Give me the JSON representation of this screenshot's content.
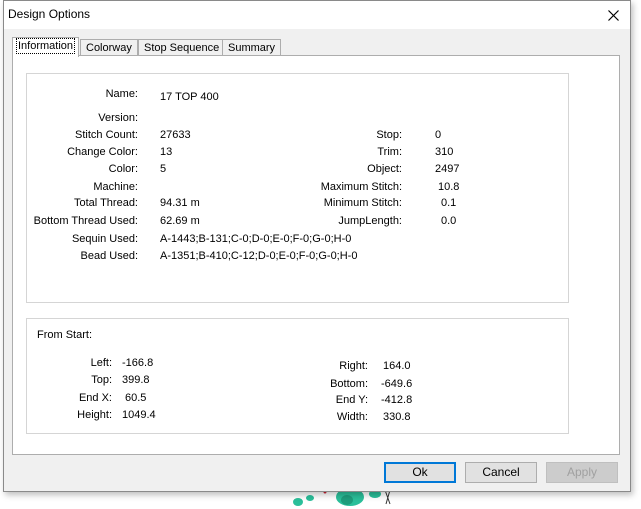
{
  "dialog": {
    "title": "Design Options",
    "tabs": [
      "Information",
      "Colorway",
      "Stop Sequence",
      "Summary"
    ],
    "active_tab": "Information",
    "buttons": {
      "ok": "Ok",
      "cancel": "Cancel",
      "apply": "Apply"
    }
  },
  "info": {
    "name": {
      "label": "Name:",
      "value": "17 TOP 400"
    },
    "left": [
      {
        "label": "Version:",
        "value": ""
      },
      {
        "label": "Stitch Count:",
        "value": "27633"
      },
      {
        "label": "Change Color:",
        "value": "13"
      },
      {
        "label": "Color:",
        "value": "5"
      },
      {
        "label": "Machine:",
        "value": ""
      },
      {
        "label": "Total Thread:",
        "value": "94.31 m"
      },
      {
        "label": "Bottom Thread Used:",
        "value": "62.69 m"
      },
      {
        "label": "Sequin Used:",
        "value": "A-1443;B-131;C-0;D-0;E-0;F-0;G-0;H-0"
      },
      {
        "label": "Bead Used:",
        "value": "A-1351;B-410;C-12;D-0;E-0;F-0;G-0;H-0"
      }
    ],
    "right": [
      {
        "label": "Stop:",
        "value": "0"
      },
      {
        "label": "Trim:",
        "value": "310"
      },
      {
        "label": "Object:",
        "value": "2497"
      },
      {
        "label": "Maximum Stitch:",
        "value": "10.8"
      },
      {
        "label": "Minimum Stitch:",
        "value": "0.1"
      },
      {
        "label": "JumpLength:",
        "value": "0.0"
      }
    ]
  },
  "from_start": {
    "heading": "From Start:",
    "left": [
      {
        "label": "Left:",
        "value": "-166.8"
      },
      {
        "label": "Top:",
        "value": "399.8"
      },
      {
        "label": "End X:",
        "value": "60.5"
      },
      {
        "label": "Height:",
        "value": "1049.4"
      }
    ],
    "right": [
      {
        "label": "Right:",
        "value": "164.0"
      },
      {
        "label": "Bottom:",
        "value": "-649.6"
      },
      {
        "label": "End Y:",
        "value": "-412.8"
      },
      {
        "label": "Width:",
        "value": "330.8"
      }
    ]
  },
  "colors": {
    "tab_border": "#adadad",
    "default_button_border": "#0078d7",
    "dialog_bg": "#f0f0f0"
  }
}
